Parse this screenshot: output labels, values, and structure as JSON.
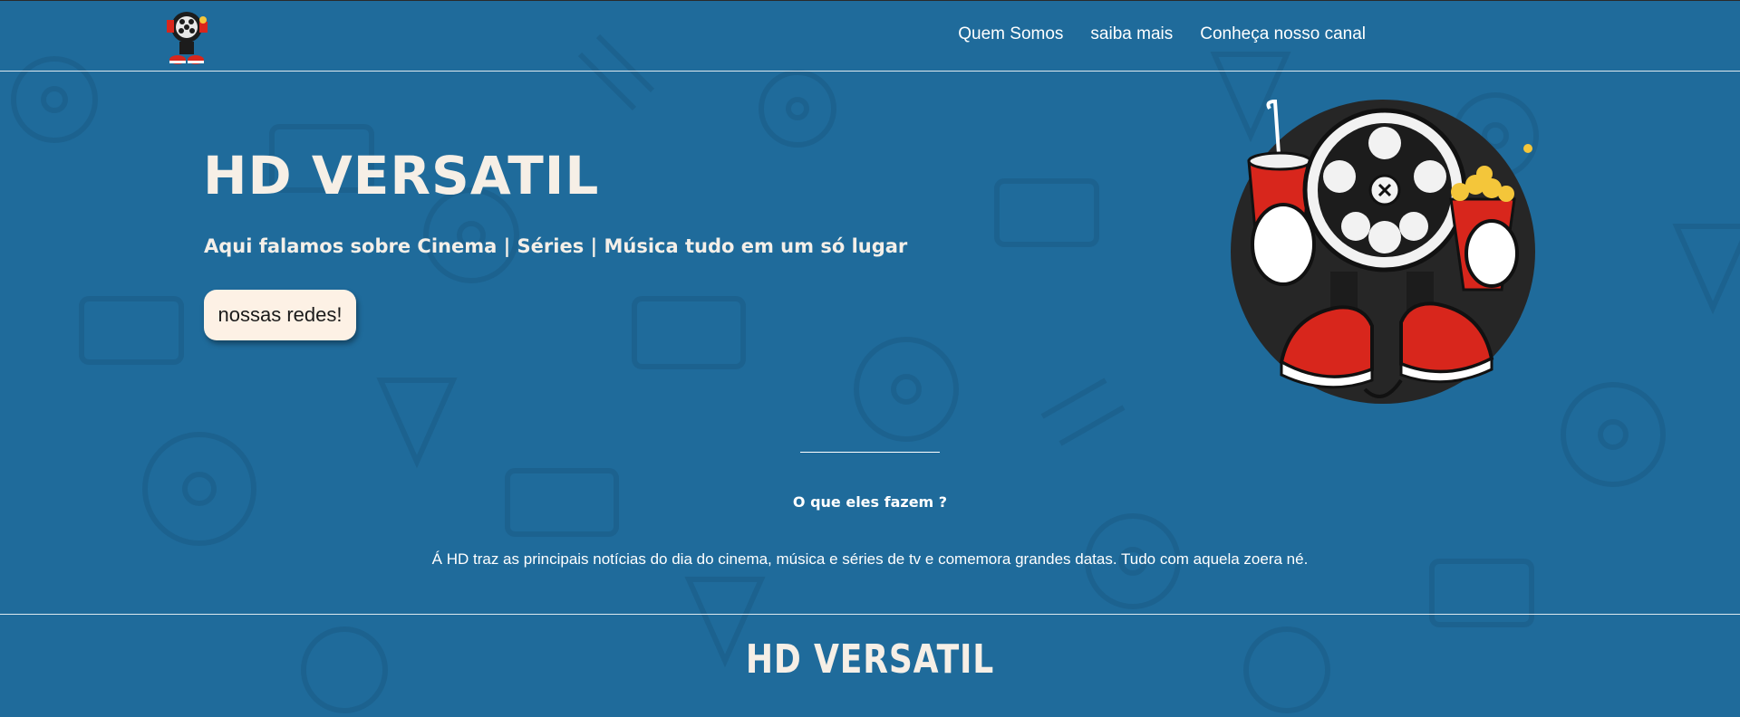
{
  "nav": {
    "items": [
      {
        "label": "Quem Somos"
      },
      {
        "label": "saiba mais"
      },
      {
        "label": "Conheça nosso canal"
      }
    ]
  },
  "hero": {
    "title": "HD VERSATIL",
    "subtitle": "Aqui falamos sobre Cinema | Séries | Música tudo em um só lugar",
    "button_label": "nossas redes!"
  },
  "about": {
    "title": "O que eles fazem ?",
    "text": "Á HD traz as principais notícias do dia do cinema, música e séries de tv e comemora grandes datas. Tudo com aquela zoera né."
  },
  "footer": {
    "title": "HD VERSATIL"
  },
  "colors": {
    "background": "#1f6b9b",
    "button_bg": "#fdf1e5",
    "title_text": "#f6efe6"
  }
}
